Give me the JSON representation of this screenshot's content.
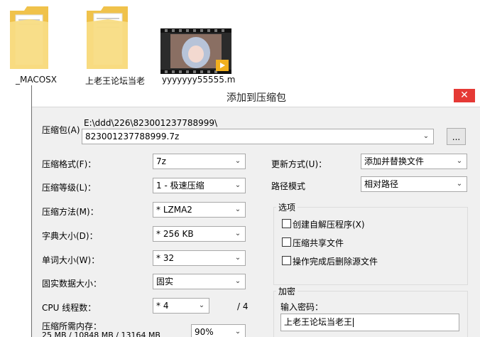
{
  "desktop": {
    "items": [
      {
        "label": "_MACOSX"
      },
      {
        "label": "上老王论坛当老"
      },
      {
        "label": "yyyyyyy55555.m"
      }
    ]
  },
  "dialog": {
    "title": "添加到压缩包",
    "close_glyph": "✕",
    "archive_label": "压缩包(A)",
    "archive_path": "E:\\ddd\\226\\823001237788999\\",
    "archive_name": "823001237788999.7z",
    "browse_label": "...",
    "fields": {
      "format": {
        "label": "压缩格式(F)：",
        "value": "7z"
      },
      "level": {
        "label": "压缩等级(L)：",
        "value": "1 - 极速压缩"
      },
      "method": {
        "label": "压缩方法(M)：",
        "value": "* LZMA2"
      },
      "dict": {
        "label": "字典大小(D)：",
        "value": "* 256 KB"
      },
      "word": {
        "label": "单词大小(W)：",
        "value": "* 32"
      },
      "solid": {
        "label": "固实数据大小：",
        "value": "固实"
      },
      "threads": {
        "label": "CPU 线程数：",
        "value": "* 4",
        "suffix": "/ 4"
      },
      "memory": {
        "label": "压缩所需内存：",
        "sub": "25 MB / 10848 MB / 13164 MB",
        "value": "90%"
      }
    },
    "update": {
      "label": "更新方式(U)：",
      "value": "添加并替换文件"
    },
    "path_mode": {
      "label": "路径模式",
      "value": "相对路径"
    },
    "options": {
      "title": "选项",
      "items": [
        {
          "label": "创建自解压程序(X)"
        },
        {
          "label": "压缩共享文件"
        },
        {
          "label": "操作完成后删除源文件"
        }
      ]
    },
    "encryption": {
      "title": "加密",
      "password_label": "输入密码：",
      "password_value": "上老王论坛当老王"
    }
  },
  "chevron": "⌄",
  "icons": [
    "folder-icon",
    "video-file-icon",
    "chevron-down-icon",
    "checkbox-icon",
    "close-icon"
  ],
  "colors": {
    "close": "#e53935",
    "folder": "#f5d36b",
    "dialog_bg": "#f0f0f0"
  }
}
